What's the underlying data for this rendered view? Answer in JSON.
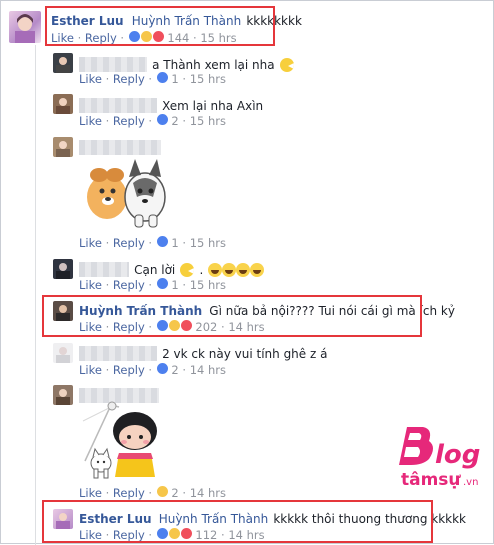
{
  "like_label": "Like",
  "reply_label": "Reply",
  "comments": [
    {
      "author": "Esther Luu",
      "mention": "Huỳnh Trấn Thành",
      "text": "kkkkkkkk",
      "count": "144",
      "time": "15 hrs"
    },
    {
      "text": "a Thành xem lại nha",
      "count": "1",
      "time": "15 hrs"
    },
    {
      "text": "Xem lại nha Axìn",
      "count": "2",
      "time": "15 hrs"
    },
    {
      "count": "1",
      "time": "15 hrs"
    },
    {
      "text": "Cạn lời",
      "count": "1",
      "time": "15 hrs"
    },
    {
      "author": "Huỳnh Trấn Thành",
      "text": "Gì nữa bả nội???? Tui nói cái gì mà ích kỷ",
      "count": "202",
      "time": "14 hrs"
    },
    {
      "text": "2 vk ck này vui tính ghê z á",
      "count": "2",
      "time": "14 hrs"
    },
    {
      "count": "2",
      "time": "14 hrs"
    },
    {
      "author": "Esther Luu",
      "mention": "Huỳnh Trấn Thành",
      "text": "kkkkk thôi thuong thương kkkkk",
      "count": "112",
      "time": "14 hrs"
    }
  ],
  "watermark": {
    "brand": "Blog",
    "site": "tâmsự.vn"
  },
  "colors": {
    "link": "#365899",
    "highlight": "#e5363b",
    "meta": "#90949c"
  }
}
